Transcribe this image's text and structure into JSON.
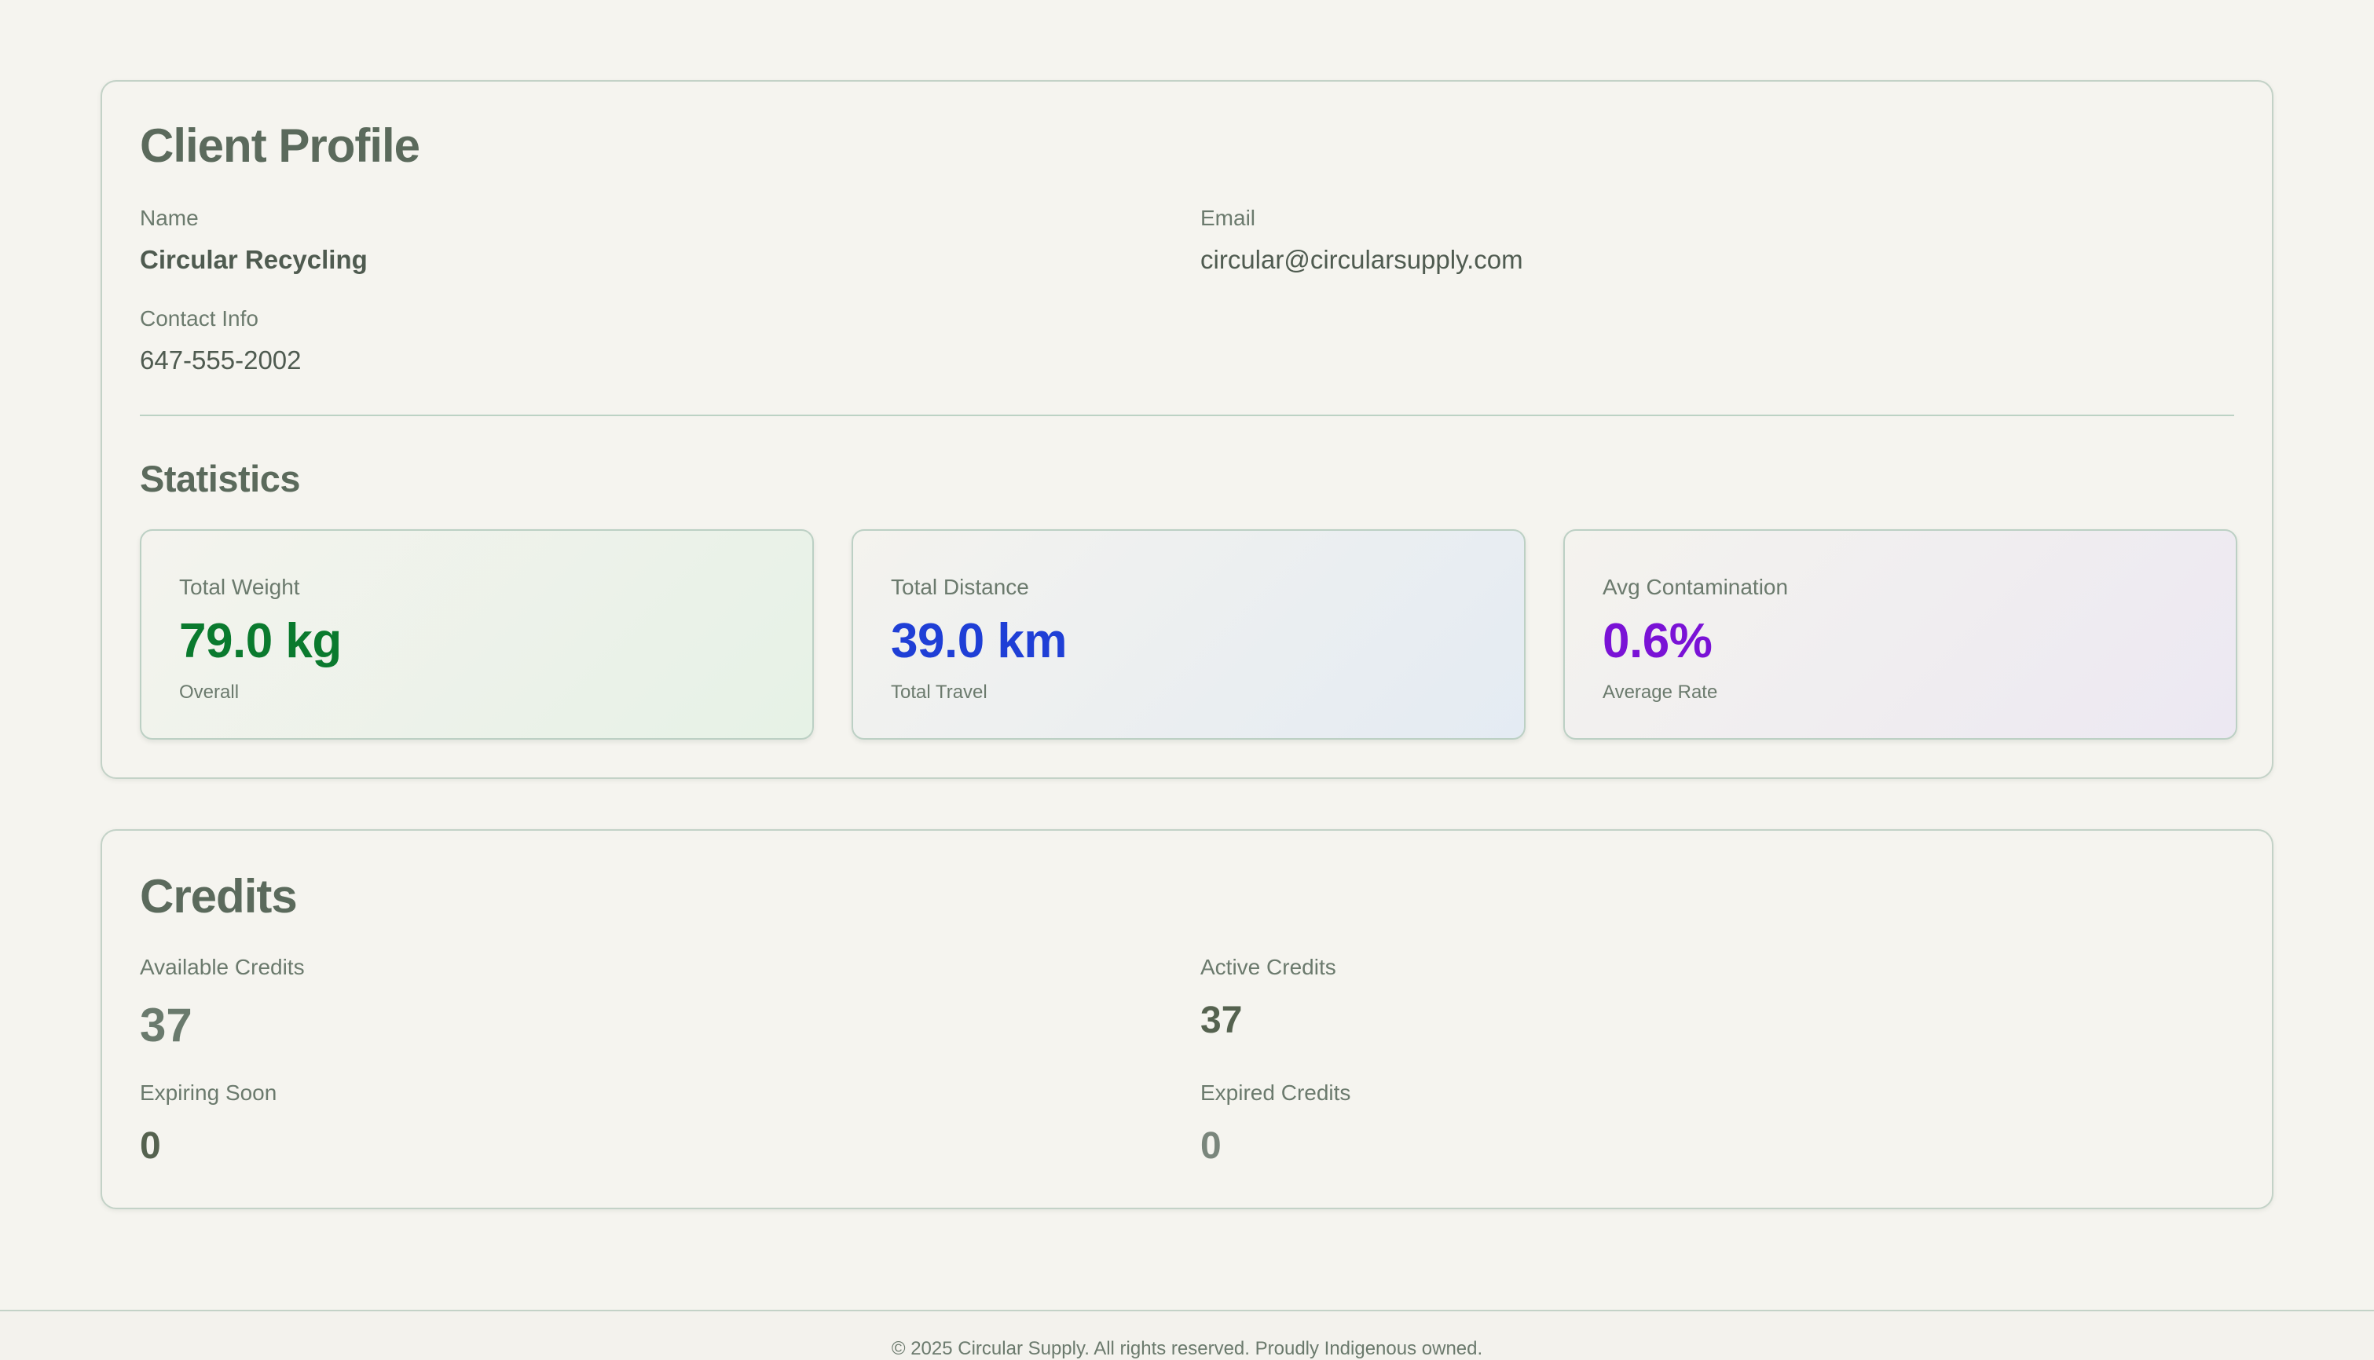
{
  "profile": {
    "title": "Client Profile",
    "name_label": "Name",
    "name_value": "Circular Recycling",
    "email_label": "Email",
    "email_value": "circular@circularsupply.com",
    "contact_label": "Contact Info",
    "contact_value": "647-555-2002"
  },
  "statistics": {
    "title": "Statistics",
    "cards": [
      {
        "label": "Total Weight",
        "value": "79.0 kg",
        "sub": "Overall",
        "color": "#0a7a2e"
      },
      {
        "label": "Total Distance",
        "value": "39.0 km",
        "sub": "Total Travel",
        "color": "#1f3fd6"
      },
      {
        "label": "Avg Contamination",
        "value": "0.6%",
        "sub": "Average Rate",
        "color": "#7a12d6"
      }
    ]
  },
  "credits": {
    "title": "Credits",
    "available_label": "Available Credits",
    "available_value": "37",
    "active_label": "Active Credits",
    "active_value": "37",
    "expiring_label": "Expiring Soon",
    "expiring_value": "0",
    "expired_label": "Expired Credits",
    "expired_value": "0"
  },
  "footer": {
    "text": "© 2025 Circular Supply. All rights reserved. Proudly Indigenous owned."
  }
}
